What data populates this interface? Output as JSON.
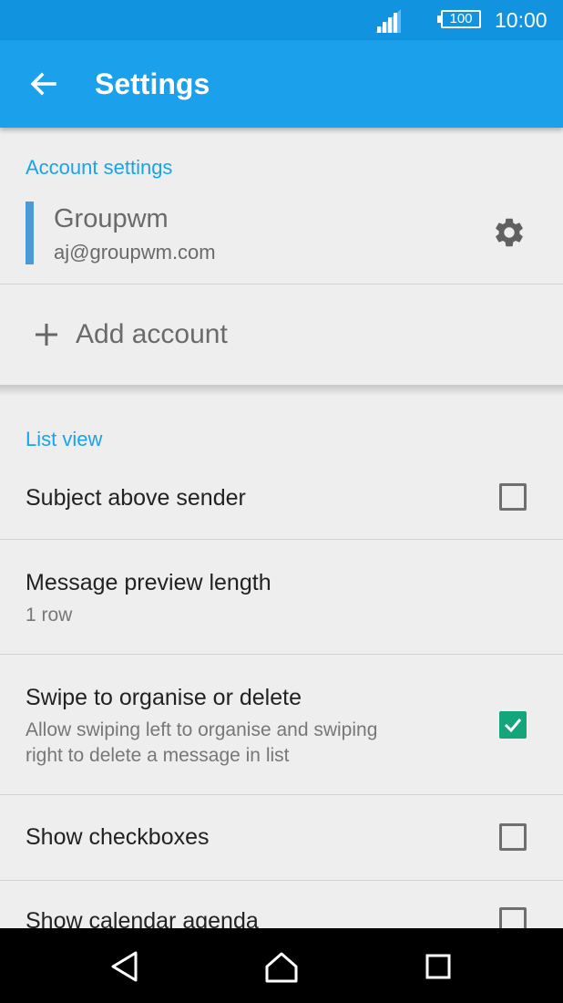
{
  "status_bar": {
    "signal_icon": "cell-signal-icon",
    "battery_level": "100",
    "time": "10:00"
  },
  "app_bar": {
    "back_icon": "arrow-back-icon",
    "title": "Settings"
  },
  "account_settings": {
    "header": "Account settings",
    "account": {
      "name": "Groupwm",
      "email": "aj@groupwm.com",
      "color": "#4a9ad8",
      "settings_icon": "gear-icon"
    },
    "add_account": {
      "icon": "plus-icon",
      "label": "Add account"
    }
  },
  "list_view": {
    "header": "List view",
    "items": [
      {
        "title": "Subject above sender",
        "checked": false
      },
      {
        "title": "Message preview length",
        "summary": "1 row"
      },
      {
        "title": "Swipe to organise or delete",
        "summary_line1": "Allow swiping left to organise and swiping",
        "summary_line2": "right to delete a message in list",
        "checked": true
      },
      {
        "title": "Show checkboxes",
        "checked": false
      },
      {
        "title": "Show calendar agenda",
        "checked": false
      }
    ]
  },
  "nav_bar": {
    "back": "nav-back-icon",
    "home": "nav-home-icon",
    "recents": "nav-recents-icon"
  },
  "colors": {
    "status_bar": "#1193e0",
    "app_bar": "#1ba0ec",
    "accent": "#1aa3e8",
    "checkbox_checked": "#14a57a",
    "background": "#eeeeee"
  }
}
